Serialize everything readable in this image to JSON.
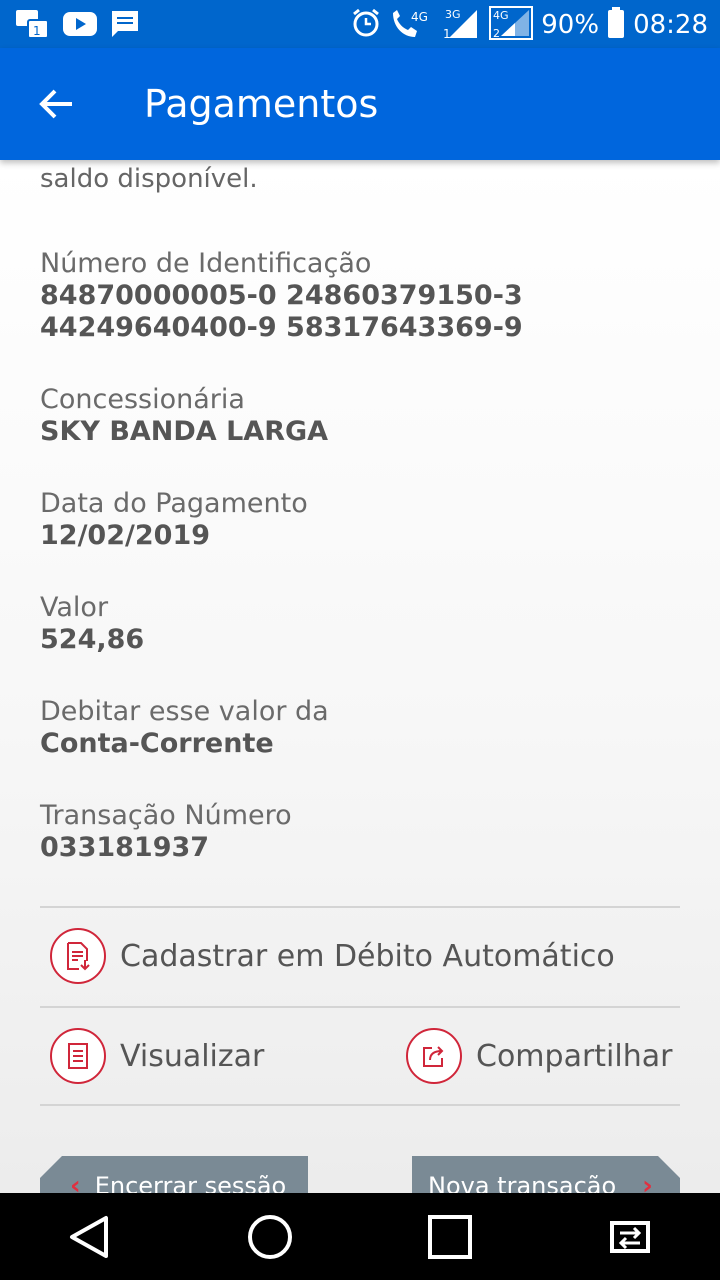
{
  "status_bar": {
    "network_4g": "4G",
    "network_3g": "3G",
    "sim2_label": "4G",
    "battery": "90%",
    "time": "08:28"
  },
  "app_bar": {
    "title": "Pagamentos"
  },
  "content": {
    "truncated_text": "saldo disponível.",
    "fields": {
      "id": {
        "label": "Número de Identificação",
        "value_line1": "84870000005-0 24860379150-3",
        "value_line2": "44249640400-9 58317643369-9"
      },
      "concessionaria": {
        "label": "Concessionária",
        "value": "SKY BANDA LARGA"
      },
      "data": {
        "label": "Data do Pagamento",
        "value": "12/02/2019"
      },
      "valor": {
        "label": "Valor",
        "value": "524,86"
      },
      "debitar": {
        "label": "Debitar esse valor da",
        "value": "Conta-Corrente"
      },
      "transacao": {
        "label": "Transação Número",
        "value": "033181937"
      }
    },
    "actions": {
      "debito_automatico": "Cadastrar em Débito Automático",
      "visualizar": "Visualizar",
      "compartilhar": "Compartilhar"
    },
    "buttons": {
      "encerrar": "Encerrar sessão",
      "nova": "Nova transação"
    }
  },
  "colors": {
    "primary": "#0066dd",
    "accent": "#d0263a",
    "button_gray": "#7a8a95"
  }
}
